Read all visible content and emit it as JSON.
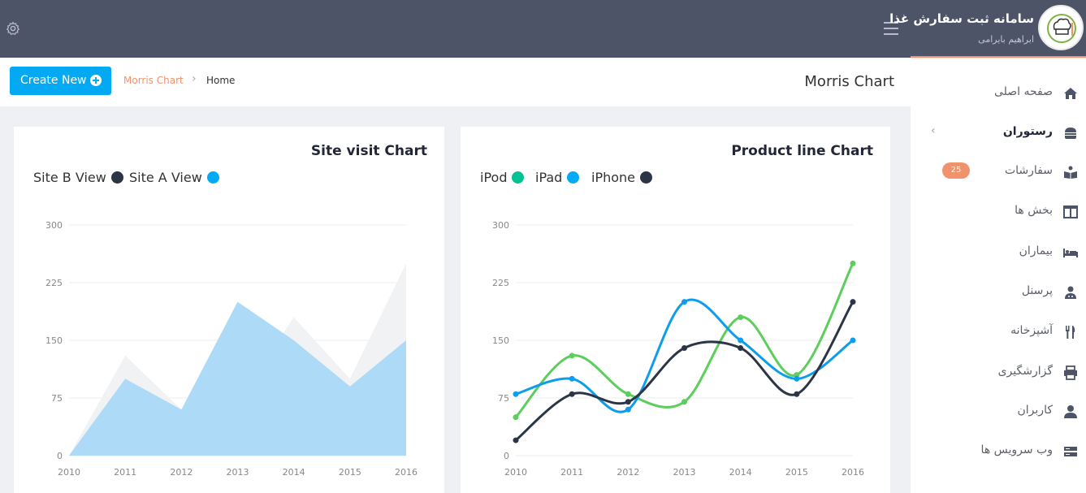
{
  "app": {
    "title": "سامانه ثبت سفارش غذا",
    "user": "ابراهیم بایرامی"
  },
  "icons": {
    "menu": "hamburger-icon",
    "settings": "gear-icon",
    "add": "plus-circle-icon",
    "breadcrumb_sep": "chevron-right-icon"
  },
  "header": {
    "create_button": "Create New",
    "breadcrumb": [
      "Morris Chart",
      "Home"
    ],
    "page_title": "Morris Chart"
  },
  "sidebar": {
    "items": [
      {
        "label": "صفحه اصلی",
        "icon": "home-icon"
      },
      {
        "label": "رستوران",
        "icon": "burger-icon",
        "active": true,
        "has_submenu": true
      },
      {
        "label": "سفارشات",
        "icon": "reader-icon",
        "badge": "25"
      },
      {
        "label": "بخش ها",
        "icon": "columns-icon"
      },
      {
        "label": "بیماران",
        "icon": "bed-icon"
      },
      {
        "label": "پرسنل",
        "icon": "staff-icon"
      },
      {
        "label": "آشپزخانه",
        "icon": "cutlery-icon"
      },
      {
        "label": "گزارشگیری",
        "icon": "printer-icon"
      },
      {
        "label": "کاربران",
        "icon": "user-icon"
      },
      {
        "label": "وب سرویس ها",
        "icon": "server-icon"
      }
    ]
  },
  "colors": {
    "accent": "#03a9f3",
    "brand_orange": "#f0926c",
    "topbar": "#4e5467",
    "site_a": "#03a9f3",
    "site_b": "#f1f2f4",
    "ipod": "#5cce5c",
    "ipad": "#0d9ded",
    "iphone": "#2b3546"
  },
  "chart_data": [
    {
      "type": "area",
      "title": "Site visit Chart",
      "x": [
        "2010",
        "2011",
        "2012",
        "2013",
        "2014",
        "2015",
        "2016"
      ],
      "ylim": [
        0,
        300
      ],
      "yticks": [
        0,
        75,
        150,
        225,
        300
      ],
      "grid": true,
      "legend_position": "top-left",
      "series": [
        {
          "name": "Site B View",
          "legend_color": "#2b3546",
          "fill": "#f1f2f4",
          "values": [
            0,
            130,
            60,
            70,
            180,
            100,
            250
          ]
        },
        {
          "name": "Site A View",
          "legend_color": "#03a9f3",
          "fill": "#a9d8f6",
          "values": [
            0,
            100,
            60,
            200,
            150,
            90,
            150
          ]
        }
      ]
    },
    {
      "type": "line",
      "title": "Product line Chart",
      "x": [
        "2010",
        "2011",
        "2012",
        "2013",
        "2014",
        "2015",
        "2016"
      ],
      "ylim": [
        0,
        300
      ],
      "yticks": [
        0,
        75,
        150,
        225,
        300
      ],
      "grid": true,
      "legend_position": "top-left",
      "series": [
        {
          "name": "iPod",
          "legend_color": "#00c292",
          "color": "#5cce5c",
          "values": [
            50,
            130,
            80,
            70,
            180,
            105,
            250
          ]
        },
        {
          "name": "iPad",
          "legend_color": "#03a9f3",
          "color": "#0d9ded",
          "values": [
            80,
            100,
            60,
            200,
            150,
            100,
            150
          ]
        },
        {
          "name": "iPhone",
          "legend_color": "#2b3546",
          "color": "#2b3546",
          "values": [
            20,
            80,
            70,
            140,
            140,
            80,
            200
          ]
        }
      ]
    }
  ]
}
